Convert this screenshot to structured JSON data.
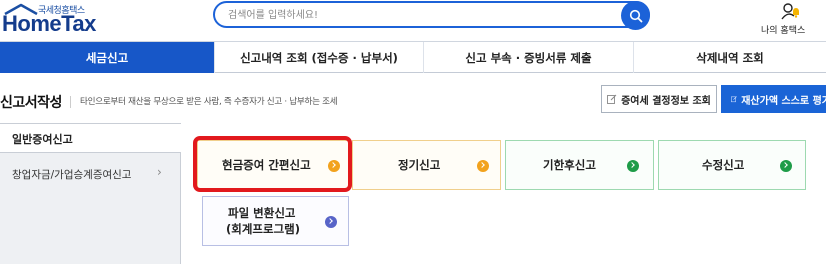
{
  "header": {
    "logo_sub": "국세청홈택스",
    "logo_main": "HomeTax",
    "search_placeholder": "검색어를 입력하세요!",
    "my_hometax": "나의 홈택스"
  },
  "nav": {
    "items": [
      {
        "label": "세금신고",
        "active": true
      },
      {
        "label": "신고내역 조회 (접수증 · 납부서)",
        "active": false
      },
      {
        "label": "신고 부속 · 증빙서류 제출",
        "active": false
      },
      {
        "label": "삭제내역 조회",
        "active": false
      }
    ]
  },
  "page": {
    "title": "신고서작성",
    "description": "타인으로부터 재산을 무상으로 받은 사람, 즉 수증자가 신고 · 납부하는 조세",
    "btn_decision": "증여세 결정정보 조회",
    "btn_self_eval": "재산가액 스스로 평가"
  },
  "left_menu": {
    "items": [
      {
        "label": "일반증여신고",
        "active": true
      },
      {
        "label": "창업자금/가업승계증여신고",
        "chevron": "›"
      }
    ]
  },
  "cards": [
    {
      "label": "현금증여 간편신고",
      "color": "orange",
      "highlighted": true
    },
    {
      "label": "정기신고",
      "color": "orange"
    },
    {
      "label": "기한후신고",
      "color": "green"
    },
    {
      "label": "수정신고",
      "color": "green"
    },
    {
      "label_line1": "파일 변환신고",
      "label_line2": "(회계프로그램)",
      "color": "purple"
    }
  ],
  "colors": {
    "brand_blue": "#1757c8",
    "highlight_red": "#e2191d",
    "orange": "#f2a21d",
    "green": "#1e9c48",
    "purple": "#5864c8"
  }
}
